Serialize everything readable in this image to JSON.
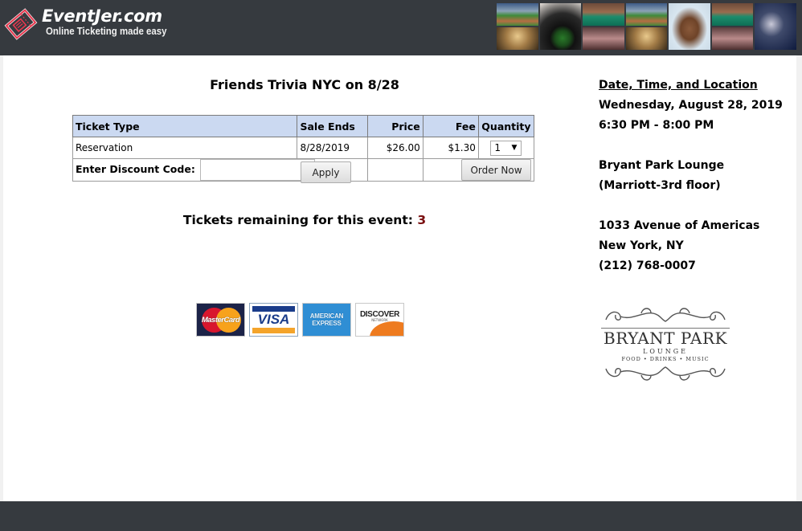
{
  "header": {
    "brand_name": "EventJer.com",
    "tagline": "Online Ticketing made easy",
    "logo_icon": "ticket-icon",
    "collage_tiles": [
      {
        "top": "baseball-stadium",
        "bottom": "banquet-hall"
      },
      {
        "full": "bowling"
      },
      {
        "top": "billiards",
        "bottom": "crowd"
      },
      {
        "top": "baseball-stadium",
        "bottom": "banquet-hall"
      },
      {
        "full": "handshake"
      },
      {
        "top": "billiards",
        "bottom": "crowd"
      },
      {
        "full": "dance-party"
      }
    ]
  },
  "event": {
    "title": "Friends Trivia NYC on 8/28",
    "remaining_label": "Tickets remaining for this event:",
    "remaining_count": "3"
  },
  "ticket_table": {
    "columns": [
      "Ticket Type",
      "Sale Ends",
      "Price",
      "Fee",
      "Quantity"
    ],
    "rows": [
      {
        "type": "Reservation",
        "sale_ends": "8/28/2019",
        "price": "$26.00",
        "fee": "$1.30",
        "quantity": "1"
      }
    ],
    "discount_label": "Enter Discount Code:",
    "discount_value": "",
    "apply_label": "Apply",
    "order_label": "Order Now"
  },
  "payment_cards": [
    {
      "name": "MasterCard",
      "icon": "mastercard-icon"
    },
    {
      "name": "VISA",
      "icon": "visa-icon"
    },
    {
      "name": "AMERICAN EXPRESS",
      "line1": "AMERICAN",
      "line2": "EXPRESS",
      "icon": "amex-icon"
    },
    {
      "name": "DISCOVER",
      "sub": "NETWORK",
      "icon": "discover-icon"
    }
  ],
  "details": {
    "heading": "Date, Time, and Location",
    "date": "Wednesday, August 28, 2019",
    "time": "6:30 PM - 8:00 PM",
    "venue": "Bryant Park Lounge",
    "venue_note": "(Marriott-3rd floor)",
    "address": "1033 Avenue of Americas",
    "city": "New York, NY",
    "phone": "(212) 768-0007"
  },
  "venue_logo": {
    "name": "BRYANT PARK",
    "sub": "LOUNGE",
    "tagline": "FOOD • DRINKS • MUSIC"
  },
  "colors": {
    "header_bg": "#363a3f",
    "table_header_bg": "#cbd9f1",
    "remaining_count": "#7a0f10",
    "logo_accent": "#e8384f"
  }
}
